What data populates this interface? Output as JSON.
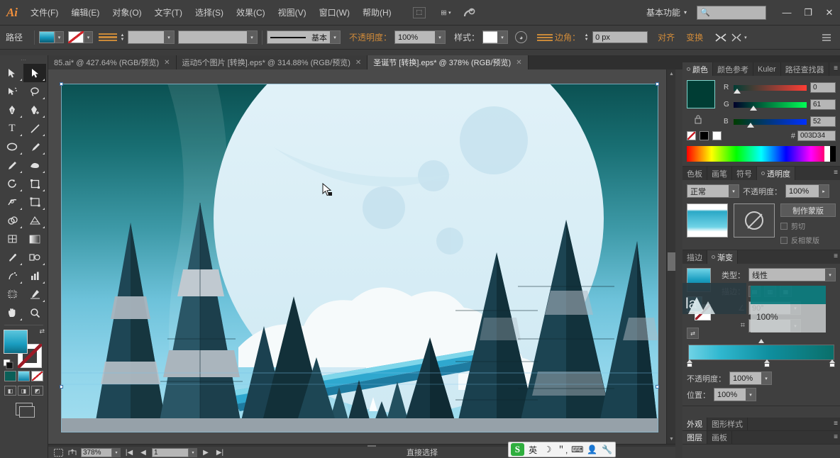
{
  "app": {
    "logo": "Ai",
    "menus": [
      "文件(F)",
      "编辑(E)",
      "对象(O)",
      "文字(T)",
      "选择(S)",
      "效果(C)",
      "视图(V)",
      "窗口(W)",
      "帮助(H)"
    ],
    "arrange_documents_icon": "arrange-documents-icon",
    "bridge_icon": "bridge-icon",
    "workspace": "基本功能",
    "workspace_caret": "▾",
    "search_placeholder": "",
    "search_value": "",
    "minimize": "—",
    "restore": "❐",
    "close": "✕"
  },
  "control_bar": {
    "object_label": "路径",
    "fill_swatch": "fill-swatch",
    "stroke_swatch": "stroke-swatch",
    "stroke_brush_label": "",
    "stroke_weight_value": "",
    "stroke_profile_value": "",
    "stroke_style_label": "基本",
    "opacity_label": "不透明度：",
    "opacity_value": "100%",
    "style_label": "样式：",
    "corner_label": "边角：",
    "corner_value": "0 px",
    "align_label": "对齐",
    "transform_label": "变换",
    "isolate_icon": "isolate-icon",
    "more_options_icon": "panel-menu-icon"
  },
  "tabs": [
    {
      "title": "85.ai* @ 427.64% (RGB/预览)",
      "close": "✕",
      "active": false
    },
    {
      "title": "运动5个图片 [转换].eps* @ 314.88% (RGB/预览)",
      "close": "✕",
      "active": false
    },
    {
      "title": "圣诞节 [转换].eps* @ 378% (RGB/预览)",
      "close": "✕",
      "active": true
    }
  ],
  "toolbar": {
    "grip": "⋯",
    "tools": [
      {
        "name": "selection-tool",
        "glyph": "⬉",
        "selected": false
      },
      {
        "name": "direct-selection-tool",
        "glyph": "⬈",
        "selected": true
      },
      {
        "name": "magic-wand-tool",
        "glyph": "✦",
        "selected": false
      },
      {
        "name": "lasso-tool",
        "glyph": "◠",
        "selected": false
      },
      {
        "name": "pen-tool",
        "glyph": "✎",
        "selected": false
      },
      {
        "name": "add-anchor-point-tool",
        "glyph": "✒",
        "selected": false
      },
      {
        "name": "type-tool",
        "glyph": "T",
        "selected": false
      },
      {
        "name": "line-segment-tool",
        "glyph": "╱",
        "selected": false
      },
      {
        "name": "ellipse-tool",
        "glyph": "◯",
        "selected": false
      },
      {
        "name": "paintbrush-tool",
        "glyph": "🖌",
        "selected": false
      },
      {
        "name": "pencil-tool",
        "glyph": "✏",
        "selected": false
      },
      {
        "name": "blob-brush-tool",
        "glyph": "▰",
        "selected": false
      },
      {
        "name": "rotate-tool",
        "glyph": "⟳",
        "selected": false
      },
      {
        "name": "scale-tool",
        "glyph": "⛶",
        "selected": false
      },
      {
        "name": "width-tool",
        "glyph": "◍",
        "selected": false
      },
      {
        "name": "free-transform-tool",
        "glyph": "⬚",
        "selected": false
      },
      {
        "name": "shape-builder-tool",
        "glyph": "◑",
        "selected": false
      },
      {
        "name": "perspective-grid-tool",
        "glyph": "▤",
        "selected": false
      },
      {
        "name": "mesh-tool",
        "glyph": "▩",
        "selected": false
      },
      {
        "name": "gradient-tool",
        "glyph": "▬",
        "selected": false
      },
      {
        "name": "eyedropper-tool",
        "glyph": "⚲",
        "selected": false
      },
      {
        "name": "blend-tool",
        "glyph": "◎",
        "selected": false
      },
      {
        "name": "symbol-sprayer-tool",
        "glyph": "⚘",
        "selected": false
      },
      {
        "name": "column-graph-tool",
        "glyph": "▥",
        "selected": false
      },
      {
        "name": "artboard-tool",
        "glyph": "⌗",
        "selected": false
      },
      {
        "name": "slice-tool",
        "glyph": "✂",
        "selected": false
      },
      {
        "name": "hand-tool",
        "glyph": "✋",
        "selected": false
      },
      {
        "name": "zoom-tool",
        "glyph": "🔍",
        "selected": false
      }
    ],
    "fill_stroke": "fill-and-stroke-control",
    "color_modes": [
      "color-swatch-mode",
      "gradient-mode",
      "none-mode"
    ],
    "draw_modes": [
      "draw-normal",
      "draw-behind",
      "draw-inside"
    ],
    "screen_mode": "change-screen-mode"
  },
  "canvas": {
    "artwork_title": "christmas-winter-forest-illustration",
    "colors": {
      "sky_top": "#0b5a5a",
      "sky_mid": "#2b8a96",
      "sky_low": "#6ec4dd",
      "sky_bottom": "#8fd6ec",
      "moon": "#dcf0f7",
      "moon_inner": "#cfe8f2",
      "tree_dark": "#14343f",
      "tree_mid": "#2b5566",
      "tree_light": "#9aa9b4",
      "snow": "#f4f7f8",
      "band_cyan": "#27a9d4",
      "ground": "#8e9aa2"
    },
    "selection_anchor": "anchor-point",
    "cursor": "direct-selection-cursor"
  },
  "statusbar": {
    "fit_icon": "fit-artboard-icon",
    "share_icon": "share-icon",
    "zoom_value": "378%",
    "artboard_nav_first": "|◀",
    "artboard_nav_prev": "◀",
    "artboard_number": "1",
    "artboard_nav_next": "▶",
    "artboard_nav_last": "▶|",
    "status_text": "直接选择"
  },
  "panels": {
    "color": {
      "tabs": [
        {
          "label": "颜色",
          "active": true
        },
        {
          "label": "颜色参考",
          "active": false
        },
        {
          "label": "Kuler",
          "active": false
        },
        {
          "label": "路径查找器",
          "active": false
        }
      ],
      "menu_icon": "panel-menu-icon",
      "current_swatch": "#003D34",
      "lock_icon": "lock-icon",
      "channels": [
        {
          "label": "R",
          "value": "0",
          "pct": 0
        },
        {
          "label": "G",
          "value": "61",
          "pct": 24
        },
        {
          "label": "B",
          "value": "52",
          "pct": 20
        }
      ],
      "hex_label": "#",
      "hex_value": "003D34",
      "mini_swatches": [
        "none-swatch",
        "black-swatch",
        "white-swatch"
      ]
    },
    "transparency": {
      "tabs": [
        {
          "label": "色板",
          "active": false
        },
        {
          "label": "画笔",
          "active": false
        },
        {
          "label": "符号",
          "active": false
        },
        {
          "label": "透明度",
          "active": true
        }
      ],
      "menu_icon": "panel-menu-icon",
      "blend_mode": "正常",
      "opacity_label": "不透明度：",
      "opacity_value": "100%",
      "make_mask_button": "制作蒙版",
      "clip_label": "剪切",
      "invert_label": "反相蒙版",
      "artwork_thumb": "artwork-thumbnail",
      "mask_thumb": "mask-thumbnail"
    },
    "gradient": {
      "tabs": [
        {
          "label": "描边",
          "active": false
        },
        {
          "label": "渐变",
          "active": true
        }
      ],
      "menu_icon": "panel-menu-icon",
      "type_label": "类型：",
      "type_value": "线性",
      "stroke_label": "描边：",
      "angle_label": "∠",
      "angle_value": "90°",
      "ratio_label": "⌗",
      "ratio_value": "",
      "opacity_label": "不透明度：",
      "opacity_value": "100%",
      "location_label": "位置：",
      "location_value": "100%",
      "gradient_thumb": "gradient-thumbnail",
      "reverse_icon": "reverse-gradient-icon",
      "stops": [
        {
          "position": 0,
          "color": "#6fd3e6"
        },
        {
          "position": 55,
          "color": "#0f8f9f"
        },
        {
          "position": 100,
          "color": "#0a6f6a"
        }
      ]
    },
    "appearance": {
      "tabs": [
        {
          "label": "外观",
          "active": false
        },
        {
          "label": "图形样式",
          "active": false
        }
      ],
      "menu_icon": "panel-menu-icon"
    },
    "layers": {
      "tabs": [
        {
          "label": "图层",
          "active": false
        },
        {
          "label": "画板",
          "active": false
        }
      ],
      "menu_icon": "panel-menu-icon"
    }
  },
  "ime": {
    "logo": "S",
    "mode": "英",
    "moon_icon": "moon-icon",
    "punctuation_icon": "punctuation-icon",
    "keyboard_icon": "keyboard-icon",
    "user_icon": "user-icon",
    "wrench_icon": "wrench-icon"
  }
}
